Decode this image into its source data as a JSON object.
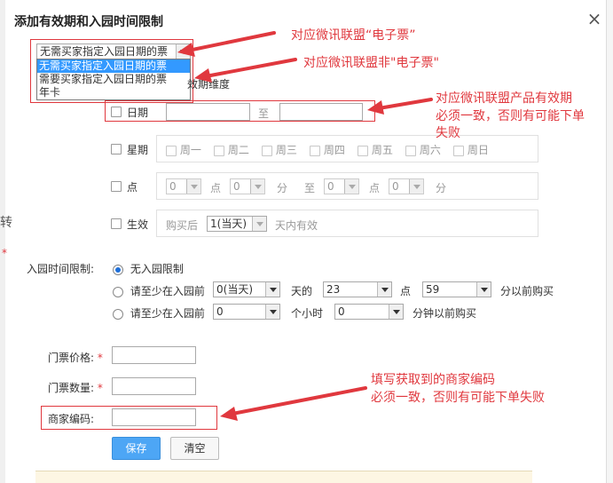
{
  "dialog": {
    "title": "添加有效期和入园时间限制",
    "close_glyph": "×"
  },
  "background_fragments": {
    "left_char": "转",
    "left_star": "*"
  },
  "ticket_type": {
    "selected": "无需买家指定入园日期的票",
    "options": [
      "无需买家指定入园日期的票",
      "需要买家指定入园日期的票",
      "年卡"
    ],
    "partial_label": "效期维度"
  },
  "date_row": {
    "label": "日期",
    "to": "至"
  },
  "week_row": {
    "label": "星期",
    "days": [
      "周一",
      "周二",
      "周三",
      "周四",
      "周五",
      "周六",
      "周日"
    ]
  },
  "time_row": {
    "label": "点",
    "start_hour": "0",
    "unit_hour": "点",
    "start_minute": "0",
    "unit_minute": "分",
    "to": "至",
    "end_hour": "0",
    "end_minute": "0"
  },
  "effective_row": {
    "label": "生效",
    "prefix": "购买后",
    "value": "1(当天)",
    "suffix": "天内有效"
  },
  "entry_limit": {
    "label": "入园时间限制:",
    "option_none": "无入园限制",
    "option_days": {
      "prefix": "请至少在入园前",
      "days_value": "0(当天)",
      "days_unit": "天的",
      "hour_value": "23",
      "hour_unit": "点",
      "minute_value": "59",
      "suffix": "分以前购买"
    },
    "option_hours": {
      "prefix": "请至少在入园前",
      "hours_value": "0",
      "hours_unit": "个小时",
      "minute_value": "0",
      "suffix": "分钟以前购买"
    }
  },
  "form": {
    "price_label": "门票价格:",
    "quantity_label": "门票数量:",
    "merchant_code_label": "商家编码:",
    "required_mark": "*"
  },
  "buttons": {
    "save": "保存",
    "clear": "清空"
  },
  "annotations": {
    "note1": "对应微讯联盟“电子票”",
    "note2": "对应微讯联盟非\"电子票\"",
    "note3_line1": "对应微讯联盟产品有效期",
    "note3_line2": "必须一致，否则有可能下单",
    "note3_line3": "失败",
    "note4_line1": "填写获取到的商家编码",
    "note4_line2": "必须一致，否则有可能下单失败"
  },
  "colors": {
    "annotation_red": "#e0383e",
    "primary_button": "#4da6f5",
    "dropdown_highlight": "#3399ff"
  }
}
